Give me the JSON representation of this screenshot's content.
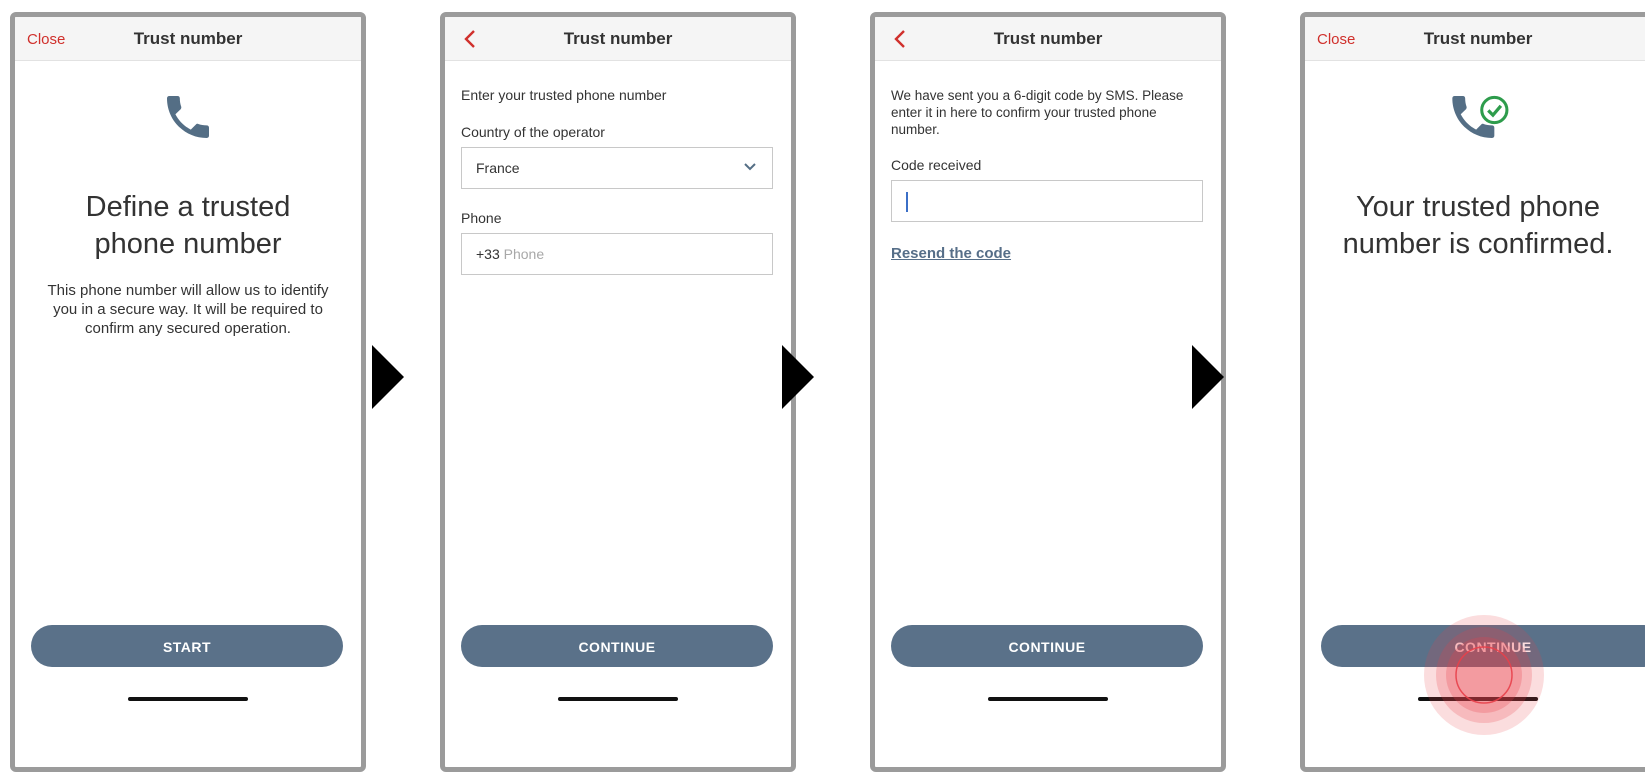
{
  "colors": {
    "accent_red": "#d0302c",
    "button": "#5a7189",
    "link": "#566e88",
    "icon": "#546e85",
    "success": "#2e9c4c",
    "frame": "#9b9b9b"
  },
  "screens": [
    {
      "title": "Trust number",
      "close_label": "Close",
      "icon": "phone-icon",
      "headline_line1": "Define a trusted",
      "headline_line2": "phone number",
      "body_line1": "This phone number will allow us to identify",
      "body_line2": "you in a secure way. It will be required to",
      "body_line3": "confirm any secured operation.",
      "button_label": "START"
    },
    {
      "title": "Trust number",
      "back_icon": "chevron-left-icon",
      "intro": "Enter your trusted phone number",
      "country_label": "Country of the operator",
      "country_value": "France",
      "phone_label": "Phone",
      "phone_prefix": "+33",
      "phone_placeholder": "Phone",
      "button_label": "CONTINUE"
    },
    {
      "title": "Trust number",
      "back_icon": "chevron-left-icon",
      "intro_line1": "We have sent you a 6-digit code by SMS. Please",
      "intro_line2": "enter it in here to confirm your trusted phone",
      "intro_line3": "number.",
      "code_label": "Code received",
      "code_value": "",
      "resend_label": "Resend the code",
      "button_label": "CONTINUE"
    },
    {
      "title": "Trust number",
      "close_label": "Close",
      "icon": "phone-check-icon",
      "headline_line1": "Your trusted phone",
      "headline_line2": "number is confirmed.",
      "button_label": "CONTINUE"
    }
  ]
}
